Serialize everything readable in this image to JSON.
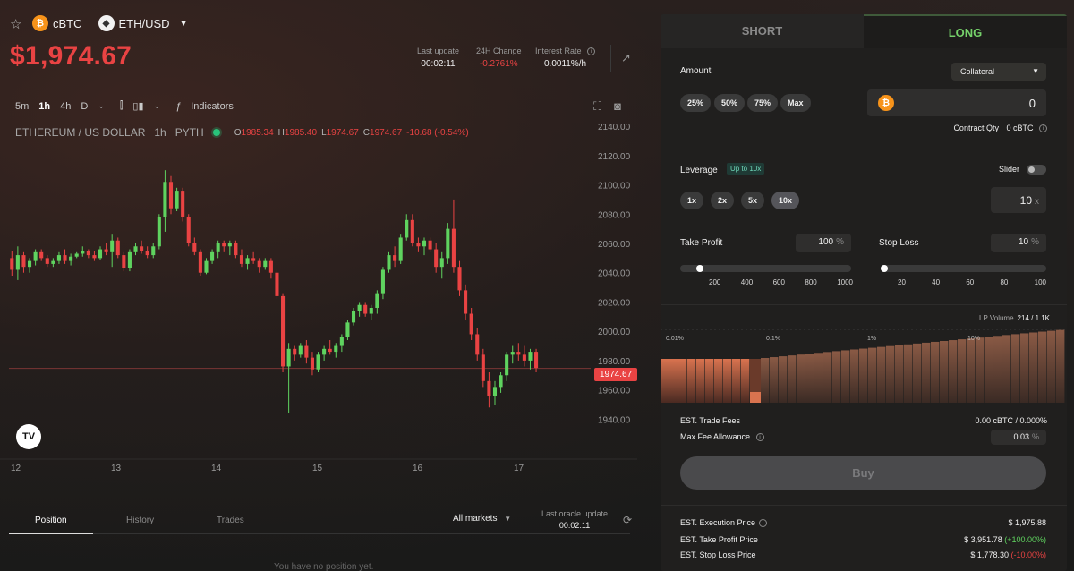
{
  "header": {
    "base_asset": "cBTC",
    "market": "ETH/USD",
    "price": "$1,974.67",
    "stats": [
      {
        "label": "Last update",
        "value": "00:02:11"
      },
      {
        "label": "24H Change",
        "value": "-0.2761%"
      },
      {
        "label": "Interest Rate",
        "value": "0.0011%/h"
      }
    ]
  },
  "toolbar": {
    "intervals": [
      "5m",
      "1h",
      "4h",
      "D"
    ],
    "active_interval": "1h",
    "indicators_label": "Indicators"
  },
  "legend": {
    "symbol": "ETHEREUM / US DOLLAR",
    "interval": "1h",
    "source": "PYTH",
    "open_key": "O",
    "open": "1985.34",
    "high_key": "H",
    "high": "1985.40",
    "low_key": "L",
    "low": "1974.67",
    "close_key": "C",
    "close": "1974.67",
    "change": "-10.68 (-0.54%)"
  },
  "chart_data": {
    "type": "candlestick",
    "x_tick_labels": [
      "12",
      "13",
      "14",
      "15",
      "16",
      "17"
    ],
    "y_tick_labels": [
      "2140.00",
      "2120.00",
      "2100.00",
      "2080.00",
      "2060.00",
      "2040.00",
      "2020.00",
      "2000.00",
      "1980.00",
      "1960.00",
      "1940.00"
    ],
    "ylim": [
      1928,
      2148
    ],
    "last_price_label": "1974.67",
    "last_price": 1974.67,
    "up_color": "#5fd35f",
    "down_color": "#e94343",
    "candles": [
      [
        2050,
        2055,
        2038,
        2042
      ],
      [
        2042,
        2058,
        2035,
        2052
      ],
      [
        2052,
        2054,
        2040,
        2044
      ],
      [
        2044,
        2050,
        2040,
        2048
      ],
      [
        2048,
        2056,
        2045,
        2054
      ],
      [
        2054,
        2056,
        2048,
        2050
      ],
      [
        2050,
        2052,
        2044,
        2046
      ],
      [
        2046,
        2050,
        2044,
        2048
      ],
      [
        2048,
        2054,
        2046,
        2052
      ],
      [
        2052,
        2056,
        2046,
        2048
      ],
      [
        2048,
        2053,
        2045,
        2051
      ],
      [
        2051,
        2054,
        2050,
        2053
      ],
      [
        2053,
        2058,
        2051,
        2055
      ],
      [
        2055,
        2056,
        2050,
        2052
      ],
      [
        2052,
        2055,
        2048,
        2050
      ],
      [
        2050,
        2058,
        2049,
        2056
      ],
      [
        2056,
        2060,
        2052,
        2054
      ],
      [
        2054,
        2066,
        2044,
        2062
      ],
      [
        2062,
        2064,
        2050,
        2052
      ],
      [
        2052,
        2054,
        2041,
        2043
      ],
      [
        2043,
        2056,
        2041,
        2054
      ],
      [
        2054,
        2060,
        2052,
        2058
      ],
      [
        2058,
        2062,
        2053,
        2055
      ],
      [
        2055,
        2058,
        2050,
        2052
      ],
      [
        2052,
        2060,
        2050,
        2058
      ],
      [
        2058,
        2080,
        2056,
        2078
      ],
      [
        2078,
        2110,
        2068,
        2102
      ],
      [
        2102,
        2106,
        2080,
        2084
      ],
      [
        2084,
        2098,
        2082,
        2096
      ],
      [
        2096,
        2098,
        2075,
        2078
      ],
      [
        2078,
        2080,
        2058,
        2060
      ],
      [
        2060,
        2064,
        2052,
        2054
      ],
      [
        2054,
        2056,
        2038,
        2040
      ],
      [
        2040,
        2050,
        2039,
        2048
      ],
      [
        2048,
        2056,
        2046,
        2054
      ],
      [
        2054,
        2062,
        2050,
        2060
      ],
      [
        2060,
        2062,
        2054,
        2058
      ],
      [
        2058,
        2062,
        2052,
        2060
      ],
      [
        2060,
        2062,
        2050,
        2052
      ],
      [
        2052,
        2056,
        2044,
        2046
      ],
      [
        2046,
        2052,
        2042,
        2050
      ],
      [
        2050,
        2054,
        2046,
        2048
      ],
      [
        2048,
        2050,
        2040,
        2044
      ],
      [
        2044,
        2050,
        2042,
        2048
      ],
      [
        2048,
        2050,
        2036,
        2040
      ],
      [
        2040,
        2042,
        2022,
        2024
      ],
      [
        2024,
        2026,
        1972,
        1976
      ],
      [
        1976,
        1992,
        1944,
        1988
      ],
      [
        1988,
        1990,
        1980,
        1984
      ],
      [
        1984,
        1992,
        1982,
        1990
      ],
      [
        1990,
        1994,
        1978,
        1982
      ],
      [
        1982,
        1986,
        1970,
        1974
      ],
      [
        1974,
        1986,
        1972,
        1984
      ],
      [
        1984,
        1990,
        1980,
        1988
      ],
      [
        1988,
        1994,
        1984,
        1986
      ],
      [
        1986,
        1992,
        1982,
        1990
      ],
      [
        1990,
        1998,
        1986,
        1996
      ],
      [
        1996,
        2008,
        1994,
        2006
      ],
      [
        2006,
        2016,
        2004,
        2014
      ],
      [
        2014,
        2020,
        2010,
        2018
      ],
      [
        2018,
        2020,
        2010,
        2012
      ],
      [
        2012,
        2018,
        2008,
        2016
      ],
      [
        2016,
        2028,
        2012,
        2026
      ],
      [
        2026,
        2044,
        2022,
        2042
      ],
      [
        2042,
        2054,
        2040,
        2052
      ],
      [
        2052,
        2058,
        2044,
        2048
      ],
      [
        2048,
        2066,
        2046,
        2064
      ],
      [
        2064,
        2080,
        2062,
        2076
      ],
      [
        2076,
        2080,
        2058,
        2060
      ],
      [
        2060,
        2064,
        2054,
        2058
      ],
      [
        2058,
        2064,
        2052,
        2062
      ],
      [
        2062,
        2064,
        2054,
        2056
      ],
      [
        2056,
        2060,
        2040,
        2044
      ],
      [
        2044,
        2054,
        2036,
        2050
      ],
      [
        2050,
        2074,
        2046,
        2070
      ],
      [
        2070,
        2090,
        2040,
        2044
      ],
      [
        2044,
        2048,
        2024,
        2028
      ],
      [
        2028,
        2032,
        2008,
        2012
      ],
      [
        2012,
        2016,
        1994,
        1998
      ],
      [
        1998,
        2002,
        1980,
        1984
      ],
      [
        1984,
        1988,
        1962,
        1966
      ],
      [
        1966,
        1972,
        1948,
        1956
      ],
      [
        1956,
        1966,
        1950,
        1962
      ],
      [
        1962,
        1972,
        1958,
        1970
      ],
      [
        1970,
        1986,
        1966,
        1984
      ],
      [
        1984,
        1990,
        1978,
        1986
      ],
      [
        1986,
        1992,
        1980,
        1984
      ],
      [
        1984,
        1990,
        1976,
        1980
      ],
      [
        1980,
        1988,
        1974,
        1986
      ],
      [
        1986,
        1988,
        1972,
        1975
      ]
    ]
  },
  "bottom": {
    "tabs": [
      "Position",
      "History",
      "Trades"
    ],
    "market_filter": "All markets",
    "oracle_label": "Last oracle update",
    "oracle_value": "00:02:11",
    "empty_text": "You have no position yet."
  },
  "trade": {
    "tab_short": "SHORT",
    "tab_long": "LONG",
    "amount_label": "Amount",
    "collateral_select": "Collateral",
    "amount_presets": [
      "25%",
      "50%",
      "75%",
      "Max"
    ],
    "amount_value": "0",
    "contract_qty_label": "Contract Qty",
    "contract_qty_value": "0 cBTC",
    "leverage_label": "Leverage",
    "leverage_badge": "Up to 10x",
    "slider_label": "Slider",
    "leverage_presets": [
      "1x",
      "2x",
      "5x",
      "10x"
    ],
    "leverage_value": "10",
    "leverage_unit": "x",
    "take_profit_label": "Take Profit",
    "take_profit_value": "100",
    "take_profit_unit": "%",
    "take_profit_ticks": [
      "200",
      "400",
      "600",
      "800",
      "1000"
    ],
    "take_profit_level": 0.02,
    "stop_loss_label": "Stop Loss",
    "stop_loss_value": "10",
    "stop_loss_unit": "%",
    "stop_loss_ticks": [
      "20",
      "40",
      "60",
      "80",
      "100"
    ],
    "stop_loss_level": 0.0,
    "lp_volume_label": "LP Volume",
    "lp_volume_value": "214 / 1.1K",
    "lp_scale_labels": [
      "0.01%",
      "0.1%",
      "1%",
      "10%"
    ],
    "trade_fees_label": "EST. Trade Fees",
    "trade_fees_value": "0.00 cBTC / 0.000%",
    "max_fee_label": "Max Fee Allowance",
    "max_fee_value": "0.03",
    "max_fee_unit": "%",
    "buy_label": "Buy",
    "exec_price_label": "EST. Execution Price",
    "exec_price_value": "$ 1,975.88",
    "tp_price_label": "EST. Take Profit Price",
    "tp_price_value": "$ 3,951.78",
    "tp_price_change": "(+100.00%)",
    "sl_price_label": "EST. Stop Loss Price",
    "sl_price_value": "$ 1,778.30",
    "sl_price_change": "(-10.00%)"
  }
}
